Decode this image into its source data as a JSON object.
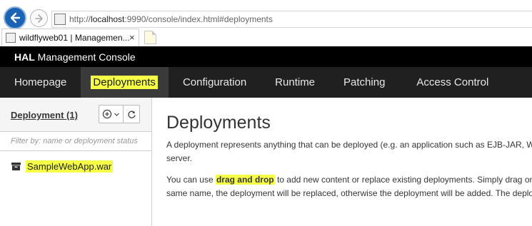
{
  "browser": {
    "url_prefix": "http://",
    "url_host": "localhost",
    "url_rest": ":9990/console/index.html#deployments",
    "tab_title": "wildflyweb01 | Managemen...",
    "tab_close": "×"
  },
  "header": {
    "brand_strong": "HAL",
    "brand_rest": " Management Console"
  },
  "nav": {
    "items": [
      {
        "label": "Homepage"
      },
      {
        "label": "Deployments"
      },
      {
        "label": "Configuration"
      },
      {
        "label": "Runtime"
      },
      {
        "label": "Patching"
      },
      {
        "label": "Access Control"
      }
    ],
    "active_index": 1
  },
  "sidebar": {
    "title": "Deployment (1)",
    "filter_placeholder": "Filter by: name or deployment status",
    "items": [
      {
        "label": "SampleWebApp.war"
      }
    ]
  },
  "main": {
    "title": "Deployments",
    "p1_line1": "A deployment represents anything that can be deployed (e.g. an application such as EJB-JAR, WAR, EAR, any kind of standard archive such as RAR or JBoss-specific deployment) into a",
    "p1_line2": "server.",
    "p2_line1_before": "You can use ",
    "p2_line1_bold": "drag and drop",
    "p2_line1_after": " to add new content or replace existing deployments. Simply drag one or more files onto the deployment column. If the deployment has the",
    "p2_line2": "same name, the deployment will be replaced, otherwise the deployment will be added. The deployment will be enabled."
  },
  "colors": {
    "highlight": "#f5ff45",
    "nav_bg": "#202020",
    "header_bg": "#000000",
    "browser_back": "#1b63b4"
  }
}
